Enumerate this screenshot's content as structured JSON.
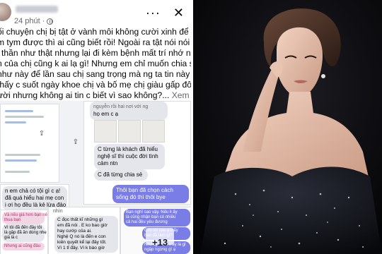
{
  "post": {
    "time": "24 phút",
    "more_icon": "more-horizontal-icon",
    "close_icon": "close-icon",
    "lines": [
      "ối chuyện chị bị tật ở vành môi không cười xinh để im",
      "m tym được thì ai cũng biết rồi! Ngoài ra tật nói nói điêu",
      "i thần như thật nhưng lại đi kèm bệnh mất trí nhớ ngắn",
      "n của chị cũng k ai lạ gì! Nhưng em chỉ muốn chia sẻ với",
      "như này để lần sau chị sang trọng mà ng ta tin này vì",
      "thấy c suốt ngày khoe chị và bố mẹ chị giàu gấp đôi bn",
      "ười nhưng không ai tin c biết vì sao không?..."
    ],
    "see_more": "Xem thêm"
  },
  "chat": {
    "top_gray_1": "nguyễn rồi hai nơi với ng",
    "top_gray_2": "họ em c ạ",
    "gray_3": [
      "C từng là khách đã hiểu",
      "nghệ sĩ thì cuộc đời tình",
      "cảm ntn"
    ],
    "gray_4": "C đã từng chia sẻ",
    "purple_1": [
      "Thôi bạn đã chọn cách",
      "sống đó thì thôi bye"
    ],
    "left_gray": [
      "n em chả có tội gì c ạ!",
      "đã quá hiểu hai mẹ con",
      "i ơi họ đều là kẻ lừa đảo"
    ],
    "pink_1": [
      "Và nếu giá hơn bạn nên",
      "thua bạn"
    ],
    "pink_2": [
      "Nhưng ai cũng đâu"
    ],
    "left_mid": [
      "Vì tôi đã đến đây tôi",
      "là gặp đã ăn dùng nhẹ",
      "giá là c"
    ],
    "mid_gray_head": "nhìn",
    "mid_gray": [
      "C đọc thất kĩ những gì",
      "em đã nói . E ko bao giờ",
      "hay cướp của ai.",
      "Nghệ Q nó là đến e con",
      "kiên quyết kể lại đây tốt.",
      "Vì 1 tỉ đây. Vì k báo giờ"
    ],
    "right_purple": [
      "Bạn nghĩ sao vậy. Nếu li ấy",
      "là cũng nhận bạn có nhiều",
      "cả hai đều yêu đương"
    ],
    "right_purple_2": [
      "Còn tôi sao ạ li ấy",
      "bạn đã làm gì?"
    ],
    "right_purple_3": [
      "Nhưng nhận li ấy là gì",
      "ngập ngừng gì ạ"
    ],
    "plus_count": "+13",
    "share_icon": "share-icon"
  },
  "photo": {
    "alt": "portrait"
  }
}
